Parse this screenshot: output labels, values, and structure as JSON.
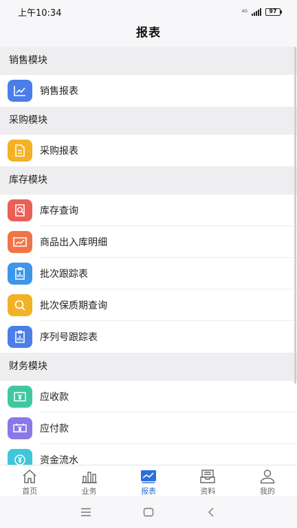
{
  "status_bar": {
    "time": "上午10:34",
    "network": "4G",
    "battery": "97"
  },
  "header": {
    "title": "报表"
  },
  "sections": [
    {
      "title": "销售模块",
      "items": [
        {
          "label": "销售报表",
          "icon": "line-chart-icon",
          "color": "#4a7ee8"
        }
      ]
    },
    {
      "title": "采购模块",
      "items": [
        {
          "label": "采购报表",
          "icon": "document-icon",
          "color": "#f3b225"
        }
      ]
    },
    {
      "title": "库存模块",
      "items": [
        {
          "label": "库存查询",
          "icon": "search-document-icon",
          "color": "#ea5f56"
        },
        {
          "label": "商品出入库明细",
          "icon": "chart-board-icon",
          "color": "#ef7548"
        },
        {
          "label": "批次跟踪表",
          "icon": "clipboard-bars-icon",
          "color": "#3c96ea"
        },
        {
          "label": "批次保质期查询",
          "icon": "search-icon",
          "color": "#f3b225"
        },
        {
          "label": "序列号跟踪表",
          "icon": "clipboard-bars-icon",
          "color": "#4a7ee8"
        }
      ]
    },
    {
      "title": "财务模块",
      "items": [
        {
          "label": "应收款",
          "icon": "yuan-card-icon",
          "color": "#3fc8a0"
        },
        {
          "label": "应付款",
          "icon": "yuan-screen-icon",
          "color": "#8c77e6"
        },
        {
          "label": "资金流水",
          "icon": "yuan-circle-icon",
          "color": "#3fc6d9"
        }
      ]
    }
  ],
  "tab_bar": {
    "tabs": [
      {
        "label": "首页",
        "icon": "home-icon"
      },
      {
        "label": "业务",
        "icon": "business-bars-icon"
      },
      {
        "label": "报表",
        "icon": "report-chart-icon"
      },
      {
        "label": "资料",
        "icon": "inbox-icon"
      },
      {
        "label": "我的",
        "icon": "person-icon"
      }
    ],
    "active_index": 2,
    "active_color": "#2c6fdc"
  },
  "nav_bar": {
    "buttons": [
      "menu-icon",
      "home-square-icon",
      "back-icon"
    ]
  }
}
